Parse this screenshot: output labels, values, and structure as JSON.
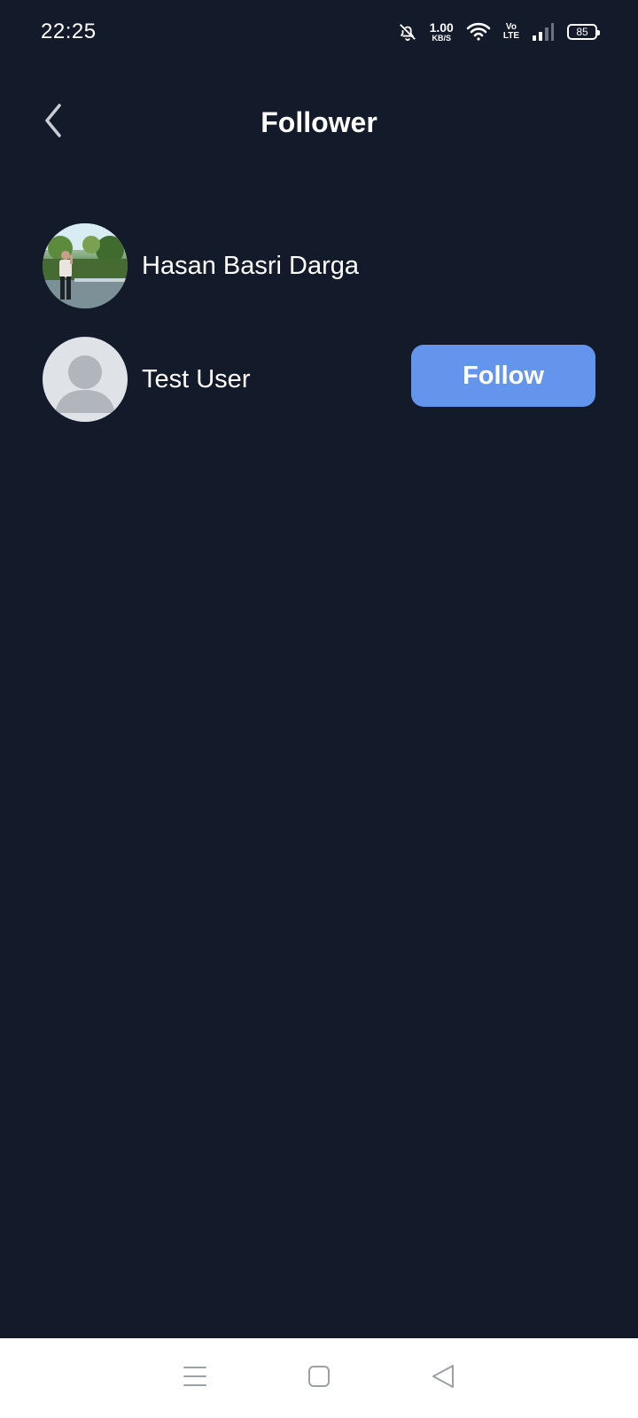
{
  "status_bar": {
    "time": "22:25",
    "net_speed_value": "1.00",
    "net_speed_unit": "KB/S",
    "volte_top": "Vo",
    "volte_bottom": "LTE",
    "battery": "85",
    "icons": [
      "bell-off-icon",
      "wifi-icon",
      "signal-icon",
      "battery-icon"
    ]
  },
  "header": {
    "title": "Follower",
    "back_icon": "chevron-left-icon"
  },
  "followers": [
    {
      "name": "Hasan Basri Darga",
      "avatar": "photo",
      "show_follow": false
    },
    {
      "name": "Test User",
      "avatar": "default",
      "show_follow": true,
      "follow_label": "Follow"
    }
  ],
  "nav_bar": {
    "icons": [
      "menu-icon",
      "home-square-icon",
      "back-triangle-icon"
    ]
  },
  "colors": {
    "background": "#131a29",
    "accent": "#6495ed",
    "text": "#ffffff"
  }
}
